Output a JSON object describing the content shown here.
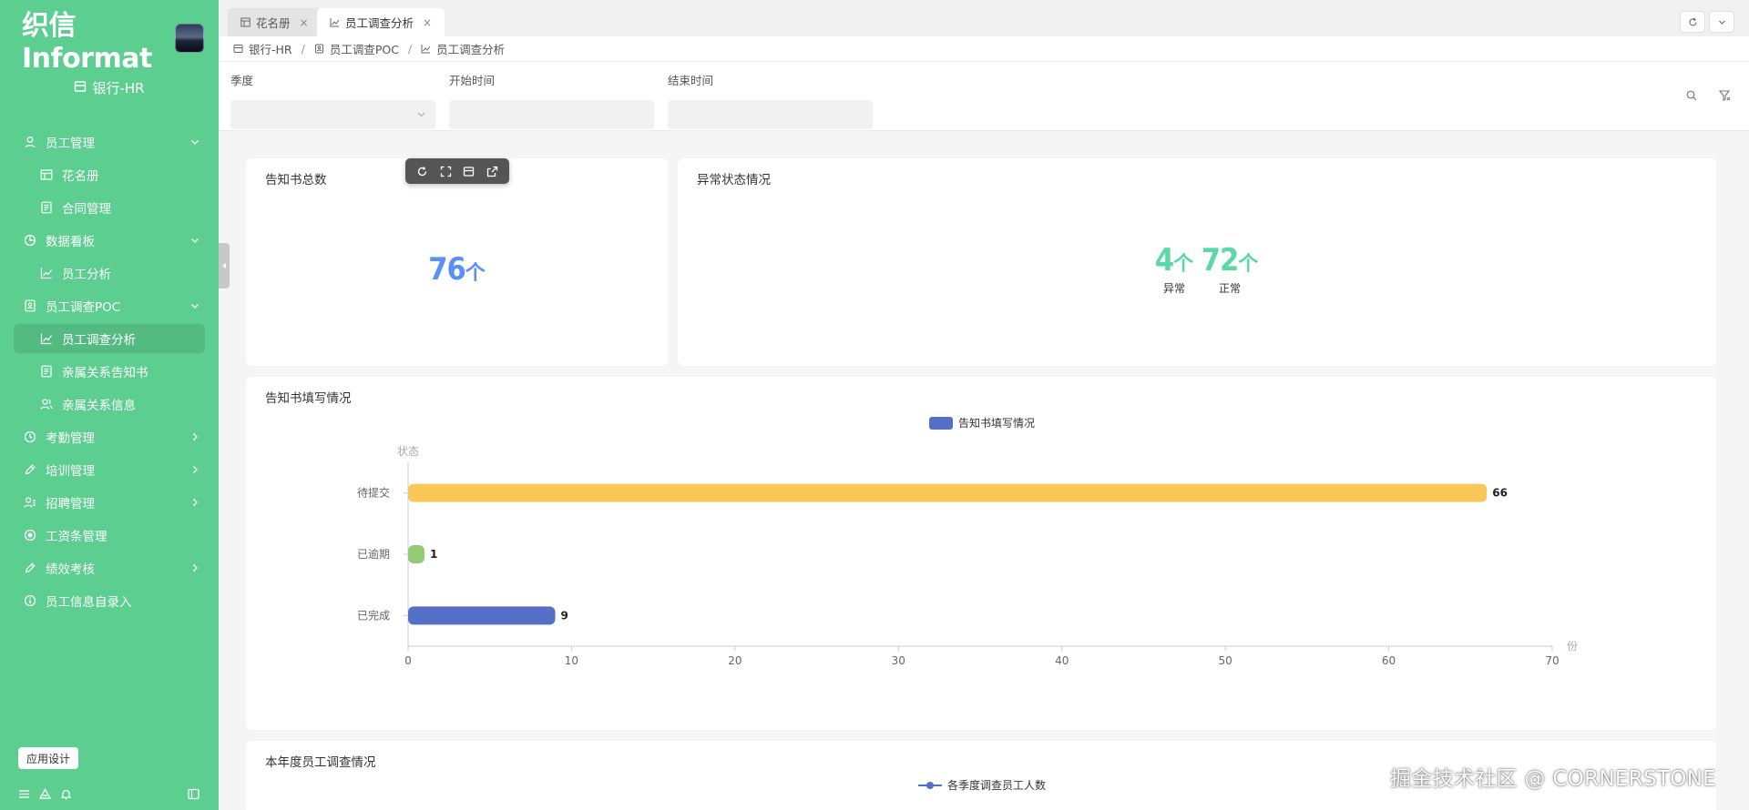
{
  "brand": {
    "name": "织信 Informat"
  },
  "org": {
    "name": "银行-HR"
  },
  "sidebar": {
    "items": [
      {
        "label": "员工管理",
        "level": 1,
        "icon": "user-icon",
        "chevron": "down"
      },
      {
        "label": "花名册",
        "level": 2,
        "icon": "table-icon"
      },
      {
        "label": "合同管理",
        "level": 2,
        "icon": "document-icon"
      },
      {
        "label": "数据看板",
        "level": 1,
        "icon": "pie-chart-icon",
        "chevron": "down"
      },
      {
        "label": "员工分析",
        "level": 2,
        "icon": "line-chart-icon"
      },
      {
        "label": "员工调查POC",
        "level": 1,
        "icon": "id-card-icon",
        "chevron": "down"
      },
      {
        "label": "员工调查分析",
        "level": 2,
        "icon": "line-chart-icon",
        "active": true
      },
      {
        "label": "亲属关系告知书",
        "level": 2,
        "icon": "document-icon"
      },
      {
        "label": "亲属关系信息",
        "level": 2,
        "icon": "users-icon"
      },
      {
        "label": "考勤管理",
        "level": 1,
        "icon": "clock-icon",
        "chevron": "right"
      },
      {
        "label": "培训管理",
        "level": 1,
        "icon": "pencil-icon",
        "chevron": "right"
      },
      {
        "label": "招聘管理",
        "level": 1,
        "icon": "user-list-icon",
        "chevron": "right"
      },
      {
        "label": "工资条管理",
        "level": 1,
        "icon": "radio-icon"
      },
      {
        "label": "绩效考核",
        "level": 1,
        "icon": "pencil-icon",
        "chevron": "right"
      },
      {
        "label": "员工信息自录入",
        "level": 1,
        "icon": "info-icon"
      }
    ],
    "app_design": "应用设计"
  },
  "tabs": [
    {
      "label": "花名册",
      "icon": "table-icon",
      "active": false
    },
    {
      "label": "员工调查分析",
      "icon": "line-chart-icon",
      "active": true
    }
  ],
  "breadcrumb": [
    "银行-HR",
    "员工调查POC",
    "员工调查分析"
  ],
  "filters": {
    "quarter": "季度",
    "start": "开始时间",
    "end": "结束时间"
  },
  "cards": {
    "total": {
      "title": "告知书总数",
      "value": "76",
      "unit": "个"
    },
    "abnormal": {
      "title": "异常状态情况",
      "items": [
        {
          "value": "4",
          "unit": "个",
          "label": "异常"
        },
        {
          "value": "72",
          "unit": "个",
          "label": "正常"
        }
      ]
    },
    "bottom": {
      "title": "本年度员工调查情况",
      "legend": "各季度调查员工人数"
    }
  },
  "colors": {
    "sidebar": "#5cce8f",
    "blue": "#5470c6",
    "green": "#91cc75",
    "yellow": "#fac858",
    "kpi_blue": "#5b8ff9",
    "kpi_green": "#5ad8a6"
  },
  "chart_data": {
    "type": "bar",
    "orientation": "horizontal",
    "title": "告知书填写情况",
    "legend": [
      "告知书填写情况"
    ],
    "ylabel": "状态",
    "xlabel": "份",
    "categories": [
      "已完成",
      "已逾期",
      "待提交"
    ],
    "values": [
      9,
      1,
      66
    ],
    "bar_colors": [
      "#5470c6",
      "#91cc75",
      "#fac858"
    ],
    "xlim": [
      0,
      70
    ],
    "xticks": [
      0,
      10,
      20,
      30,
      40,
      50,
      60,
      70
    ]
  },
  "watermark": "掘金技术社区 @ CORNERSTONE"
}
